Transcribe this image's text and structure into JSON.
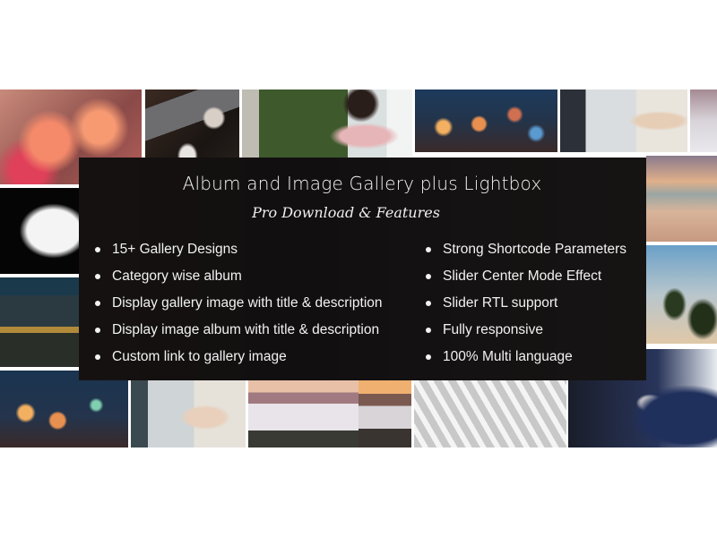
{
  "banner": {
    "title": "Album and Image Gallery plus Lightbox",
    "subtitle": "Pro Download & Features",
    "features_left": [
      "15+ Gallery Designs",
      "Category wise album",
      "Display gallery image with title & description",
      "Display image album with title & description",
      "Custom link to gallery image"
    ],
    "features_right": [
      "Strong Shortcode Parameters",
      "Slider Center Mode Effect",
      "Slider RTL support",
      "Fully responsive",
      "100% Multi language"
    ],
    "gallery_tiles": [
      "pink-flowers-photo",
      "laptop-desk-topview-photo",
      "woman-on-phone-photo",
      "city-bokeh-lights-photo",
      "woman-at-computer-photo",
      "mountain-clouds-photo",
      "office-silhouettes-photo",
      "beach-sunset-photo",
      "city-night-skyline-photo",
      "palm-trees-photo",
      "city-bokeh-lights-photo-2",
      "woman-at-computer-photo-2",
      "foggy-mountains-photo",
      "sunset-mountains-photo",
      "running-man-architecture-photo",
      "business-meeting-photo"
    ]
  }
}
